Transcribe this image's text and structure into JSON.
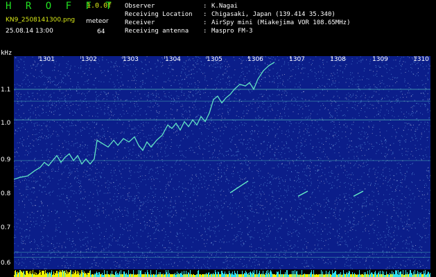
{
  "header": {
    "app_title": "H R O F F T",
    "app_version": "1.0.0f",
    "file_name": "KN9_2508141300.png",
    "mode": "meteor",
    "datetime": "25.08.14 13:00",
    "count": "64"
  },
  "info": [
    {
      "label": "Observer",
      "sep": ":",
      "value": "K.Nagai"
    },
    {
      "label": "Receiving Location",
      "sep": ":",
      "value": "Chigasaki, Japan (139.414 35.340)"
    },
    {
      "label": "Receiver",
      "sep": ":",
      "value": "AirSpy mini (Miakejima VOR 108.65MHz)"
    },
    {
      "label": "Receiving antenna",
      "sep": ":",
      "value": "Maspro FM-3"
    }
  ],
  "axis": {
    "y_unit": "kHz",
    "y_labels": [
      "1.1",
      "1.0",
      "0.9",
      "0.8",
      "0.7",
      "0.6"
    ],
    "x_labels": [
      "1301",
      "1302",
      "1303",
      "1304",
      "1305",
      "1306",
      "1307",
      "1308",
      "1309",
      "1310"
    ]
  },
  "colors": {
    "plot_background": "#0b1e8a",
    "noise": "#6fb4f0",
    "trace": "#66f0c8",
    "header_green": "#22e022",
    "header_yellow": "#d8e818",
    "bar_yellow": "#f0f000",
    "bar_cyan": "#30e0f0"
  }
}
